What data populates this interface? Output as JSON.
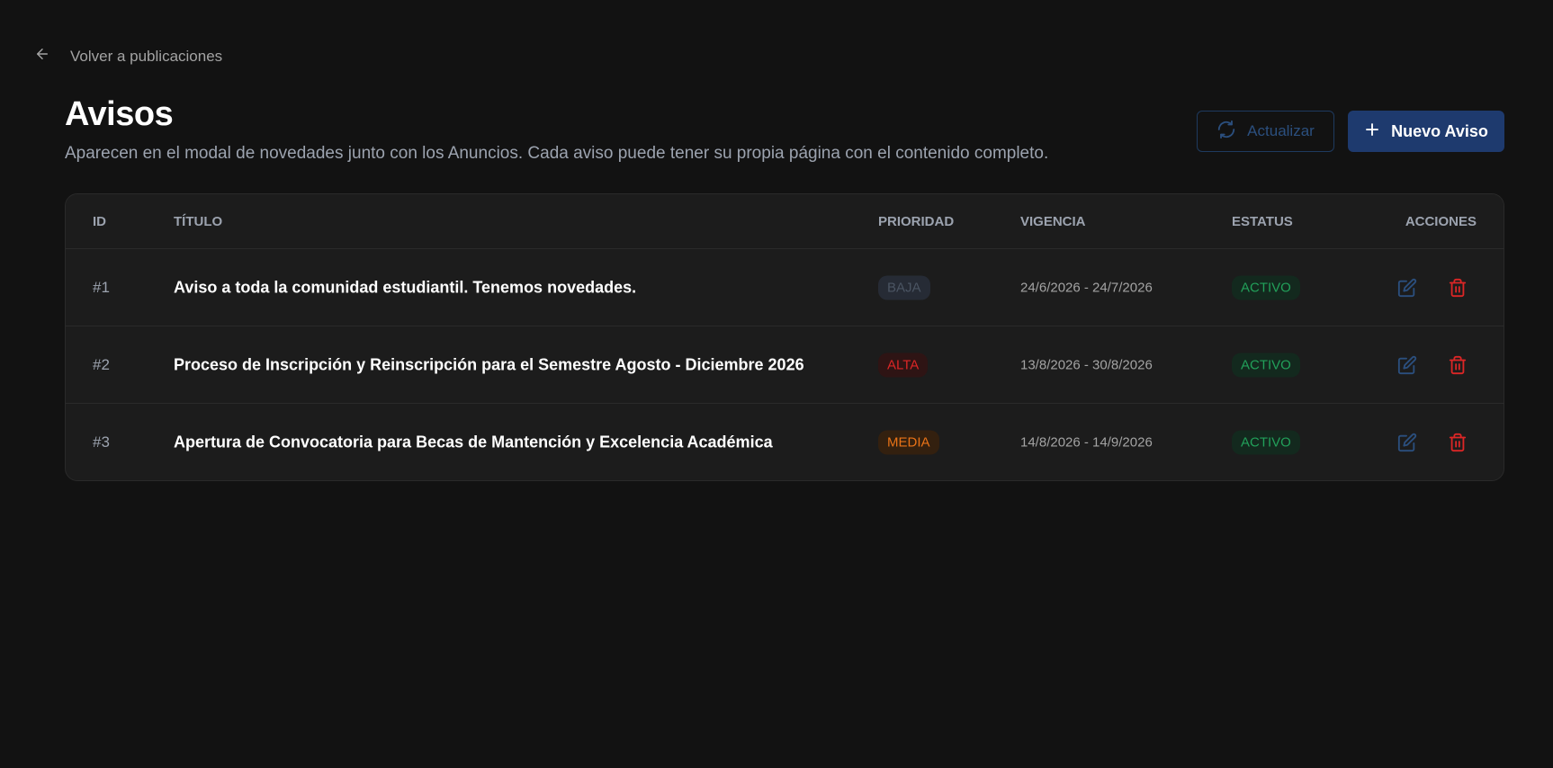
{
  "nav": {
    "back_label": "Volver a publicaciones"
  },
  "header": {
    "title": "Avisos",
    "subtitle": "Aparecen en el modal de novedades junto con los Anuncios. Cada aviso puede tener su propia página con el contenido completo.",
    "refresh_label": "Actualizar",
    "new_label": "Nuevo Aviso"
  },
  "table": {
    "columns": {
      "id": "ID",
      "title": "TÍTULO",
      "priority": "PRIORIDAD",
      "validity": "VIGENCIA",
      "status": "ESTATUS",
      "actions": "ACCIONES"
    },
    "rows": [
      {
        "id": "#1",
        "title": "Aviso a toda la comunidad estudiantil. Tenemos novedades.",
        "priority": "BAJA",
        "validity": "24/6/2026 - 24/7/2026",
        "status": "ACTIVO"
      },
      {
        "id": "#2",
        "title": "Proceso de Inscripción y Reinscripción para el Semestre Agosto - Diciembre 2026",
        "priority": "ALTA",
        "validity": "13/8/2026 - 30/8/2026",
        "status": "ACTIVO"
      },
      {
        "id": "#3",
        "title": "Apertura de Convocatoria para Becas de Mantención y Excelencia Académica",
        "priority": "MEDIA",
        "validity": "14/8/2026 - 14/9/2026",
        "status": "ACTIVO"
      }
    ]
  },
  "colors": {
    "background": "#121212",
    "card": "#1c1c1c",
    "primary_button": "#1e3a6e",
    "priority_baja": "#4b5563",
    "priority_alta": "#dc2626",
    "priority_media": "#ea7317",
    "status_activo": "#22a05a",
    "edit_icon": "#2b4f7e",
    "delete_icon": "#dc2626"
  }
}
